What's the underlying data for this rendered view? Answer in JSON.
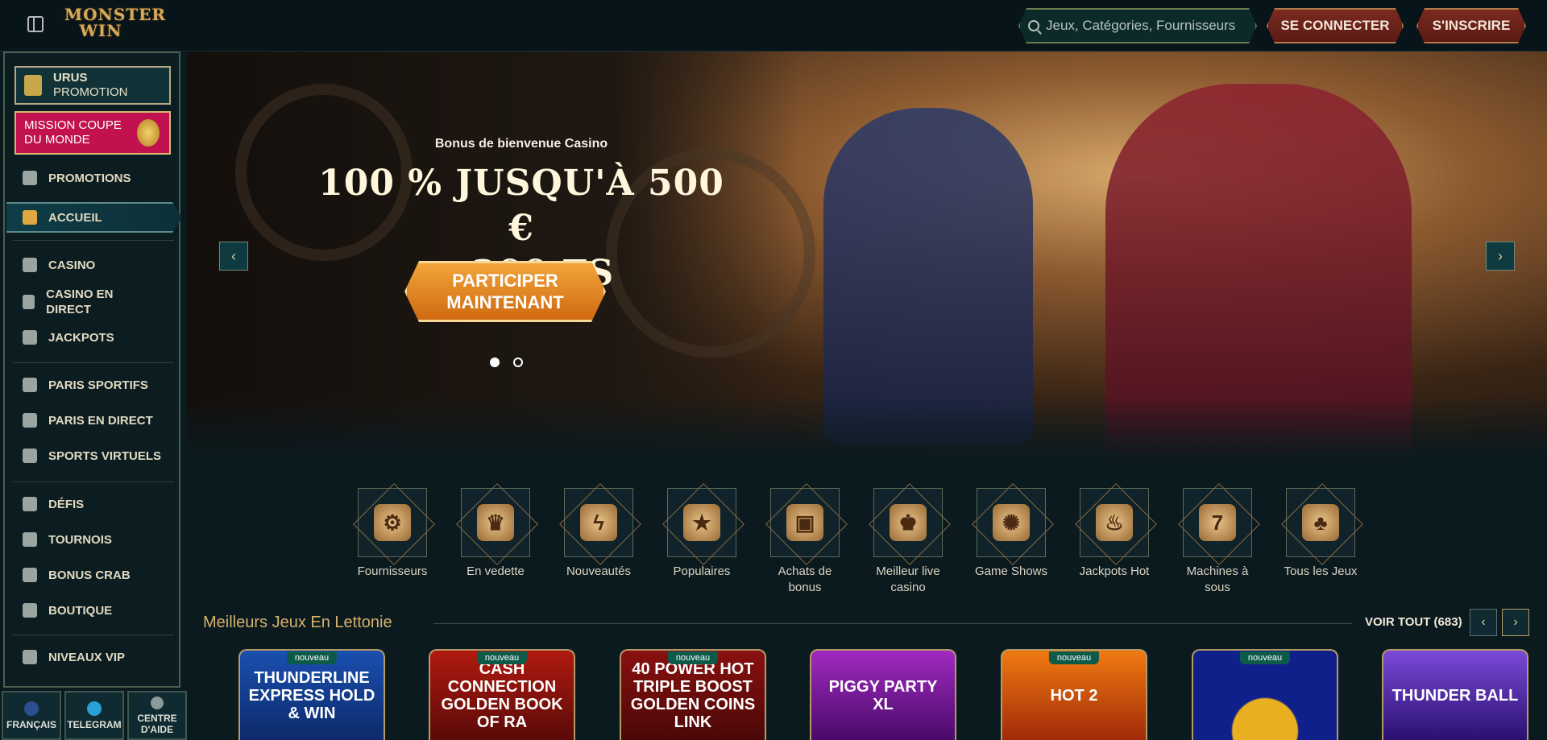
{
  "header": {
    "logo_line1": "MONSTER",
    "logo_line2": "WIN",
    "search_placeholder": "Jeux, Catégories, Fournisseurs",
    "login_label": "SE CONNECTER",
    "register_label": "S'INSCRIRE"
  },
  "sidebar": {
    "promo_urus_line1": "URUS",
    "promo_urus_line2": "PROMOTION",
    "promo_mission": "MISSION COUPE DU MONDE",
    "items": [
      {
        "label": "PROMOTIONS",
        "icon": "gift-icon"
      },
      {
        "label": "ACCUEIL",
        "icon": "home-icon"
      },
      {
        "label": "CASINO",
        "icon": "slot-machine-icon"
      },
      {
        "label": "CASINO EN DIRECT",
        "icon": "cards-icon"
      },
      {
        "label": "JACKPOTS",
        "icon": "clover-icon"
      },
      {
        "label": "PARIS SPORTIFS",
        "icon": "basketball-icon"
      },
      {
        "label": "PARIS EN DIRECT",
        "icon": "live-icon"
      },
      {
        "label": "SPORTS VIRTUELS",
        "icon": "virtual-sports-icon"
      },
      {
        "label": "DÉFIS",
        "icon": "medal-icon"
      },
      {
        "label": "TOURNOIS",
        "icon": "trophy-icon"
      },
      {
        "label": "BONUS CRAB",
        "icon": "crab-icon"
      },
      {
        "label": "BOUTIQUE",
        "icon": "basket-icon"
      },
      {
        "label": "NIVEAUX VIP",
        "icon": "diamond-icon"
      }
    ],
    "bottom": {
      "language": "FRANÇAIS",
      "telegram": "TELEGRAM",
      "help_line1": "CENTRE",
      "help_line2": "D'AIDE"
    }
  },
  "hero": {
    "subtitle": "Bonus de bienvenue Casino",
    "title_line1": "100 % JUSQU'À 500 €",
    "title_line2": "+ 200 FS",
    "cta_line1": "PARTICIPER",
    "cta_line2": "MAINTENANT",
    "prev_arrow": "‹",
    "next_arrow": "›",
    "active_slide": 1,
    "total_slides": 2
  },
  "categories": [
    {
      "label": "Fournisseurs",
      "glyph": "⚙"
    },
    {
      "label": "En vedette",
      "glyph": "♛"
    },
    {
      "label": "Nouveautés",
      "glyph": "ϟ"
    },
    {
      "label": "Populaires",
      "glyph": "★"
    },
    {
      "label": "Achats de bonus",
      "glyph": "▣"
    },
    {
      "label": "Meilleur live casino",
      "glyph": "♚"
    },
    {
      "label": "Game Shows",
      "glyph": "✺"
    },
    {
      "label": "Jackpots Hot",
      "glyph": "♨"
    },
    {
      "label": "Machines à sous",
      "glyph": "7"
    },
    {
      "label": "Tous les Jeux",
      "glyph": "♣"
    }
  ],
  "section": {
    "title": "Meilleurs Jeux En Lettonie",
    "see_all": "VOIR TOUT (683)",
    "prev": "‹",
    "next": "›"
  },
  "games": [
    {
      "title": "THUNDERLINE EXPRESS HOLD & WIN",
      "badge": "nouveau",
      "color": "#1a4fb0"
    },
    {
      "title": "CASH CONNECTION GOLDEN BOOK OF RA",
      "badge": "nouveau",
      "color": "#b01a10"
    },
    {
      "title": "40 POWER HOT TRIPLE BOOST GOLDEN COINS LINK",
      "badge": "nouveau",
      "color": "#8a1010"
    },
    {
      "title": "PIGGY PARTY XL",
      "badge": "",
      "color": "#7a1aa0"
    },
    {
      "title": "HOT 2",
      "badge": "nouveau",
      "color": "#d04a0a"
    },
    {
      "title": "",
      "badge": "nouveau",
      "color": "#10208a"
    },
    {
      "title": "THUNDER BALL",
      "badge": "",
      "color": "#5a2aa8"
    }
  ]
}
